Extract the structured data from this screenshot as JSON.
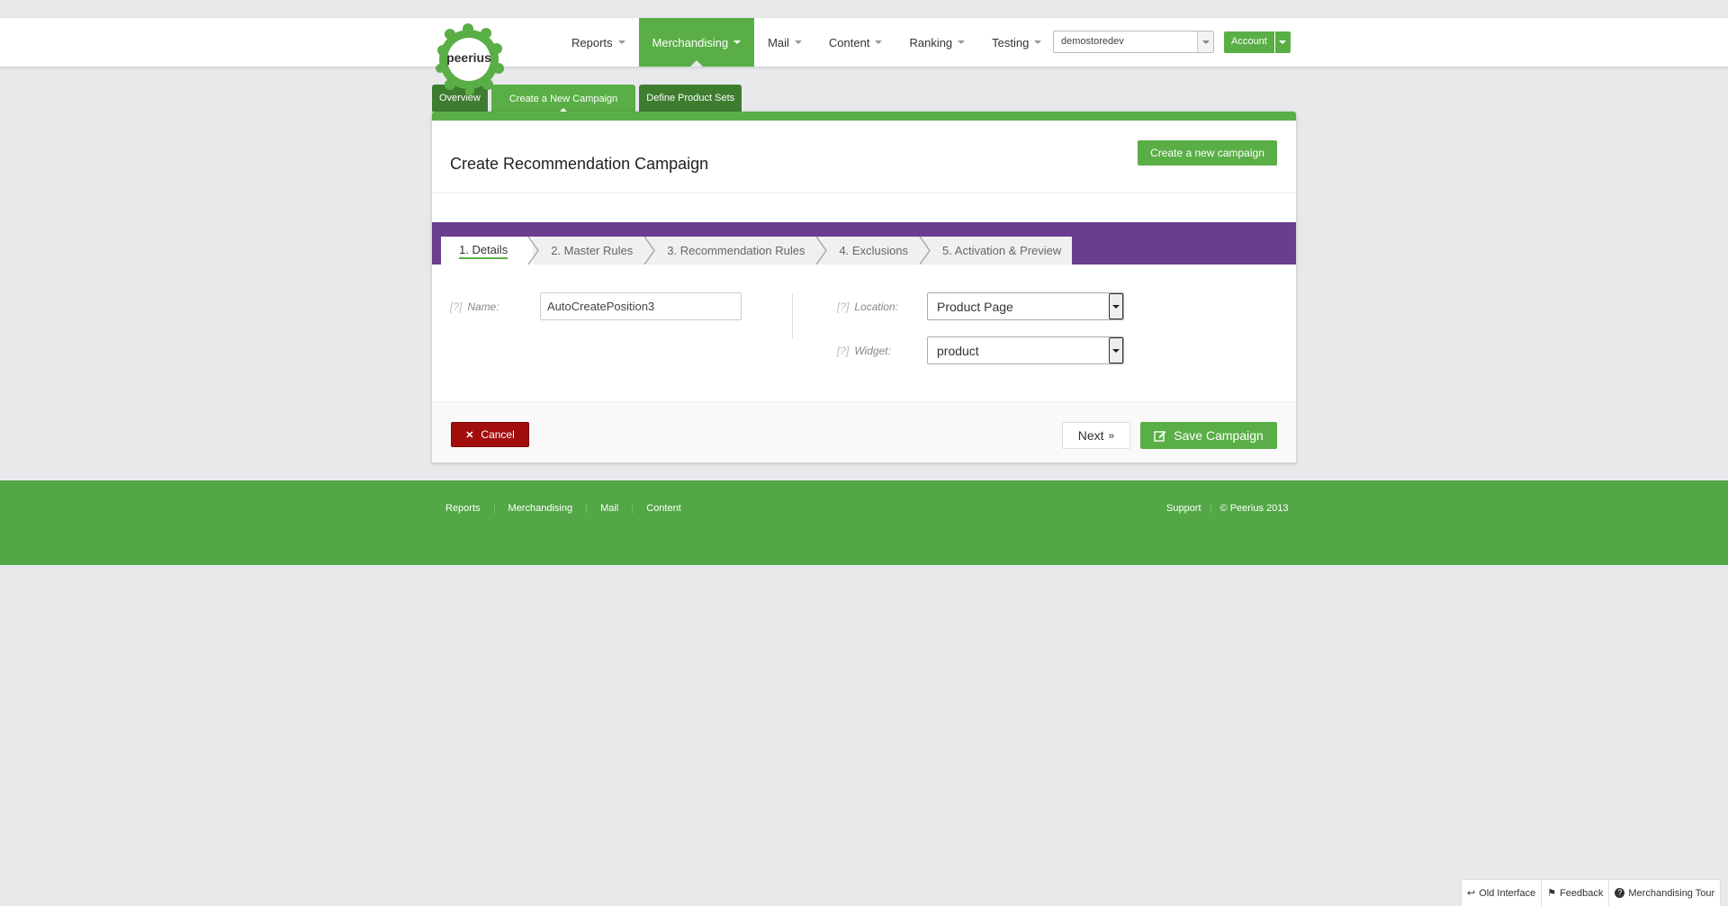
{
  "header": {
    "logo_text": "peerius",
    "nav": [
      {
        "label": "Reports"
      },
      {
        "label": "Merchandising"
      },
      {
        "label": "Mail"
      },
      {
        "label": "Content"
      },
      {
        "label": "Ranking"
      },
      {
        "label": "Testing"
      }
    ],
    "store_select": "demostoredev",
    "account_label": "Account"
  },
  "subtabs": [
    {
      "label": "Overview"
    },
    {
      "label": "Create a New Campaign"
    },
    {
      "label": "Define Product Sets"
    }
  ],
  "card": {
    "title": "Create Recommendation Campaign",
    "new_campaign_label": "Create a new campaign"
  },
  "steps": [
    {
      "label": "1. Details"
    },
    {
      "label": "2. Master Rules"
    },
    {
      "label": "3. Recommendation Rules"
    },
    {
      "label": "4. Exclusions"
    },
    {
      "label": "5. Activation & Preview"
    }
  ],
  "form": {
    "help": "[?]",
    "name_label": "Name:",
    "name_value": "AutoCreatePosition3",
    "location_label": "Location:",
    "location_value": "Product Page",
    "widget_label": "Widget:",
    "widget_value": "product"
  },
  "actions": {
    "cancel_label": "Cancel",
    "next_label": "Next",
    "save_label": "Save Campaign"
  },
  "footer": {
    "links": [
      {
        "label": "Reports"
      },
      {
        "label": "Merchandising"
      },
      {
        "label": "Mail"
      },
      {
        "label": "Content"
      }
    ],
    "support_label": "Support",
    "copyright": "© Peerius 2013"
  },
  "bottom_bar": {
    "old_interface": "Old Interface",
    "feedback": "Feedback",
    "tour": "Merchandising Tour"
  },
  "colors": {
    "brand_green": "#5aae46",
    "dark_green": "#3e7d2f",
    "purple": "#6a3d8f",
    "cancel_red": "#a20d0d"
  }
}
